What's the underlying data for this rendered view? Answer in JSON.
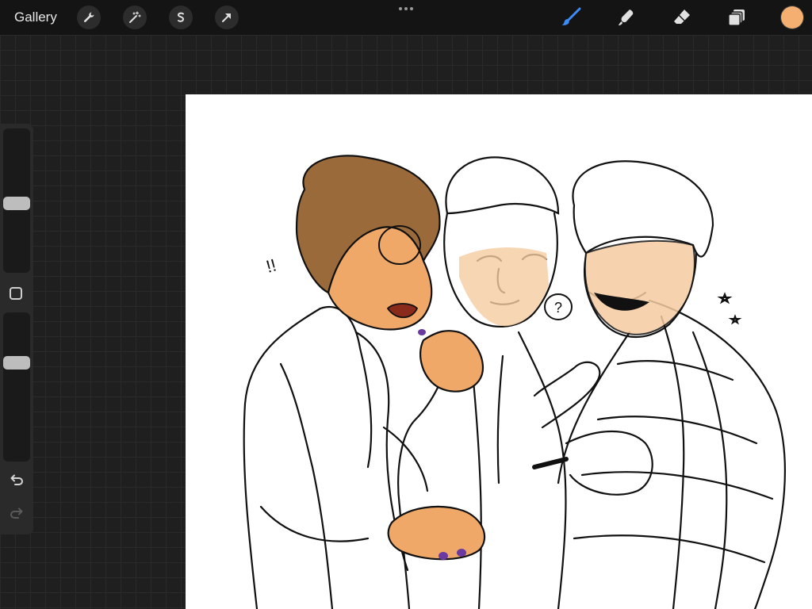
{
  "topbar": {
    "gallery_label": "Gallery",
    "left_tools": [
      "wrench-icon",
      "magic-wand-icon",
      "selection-icon",
      "transform-arrow-icon"
    ],
    "right_tools": [
      "brush-icon",
      "smudge-icon",
      "eraser-icon",
      "layers-icon"
    ],
    "active_tool": "brush-icon",
    "current_color": "#f5b071",
    "accent_color": "#3d8cf5"
  },
  "sidebar": {
    "brush_size": 0.48,
    "opacity": 0.68,
    "undo_icon": "undo-icon",
    "redo_icon": "redo-icon"
  },
  "canvas": {
    "background_color": "#ffffff",
    "speech_bubble_text": "?",
    "exclamation_text": "!!"
  }
}
